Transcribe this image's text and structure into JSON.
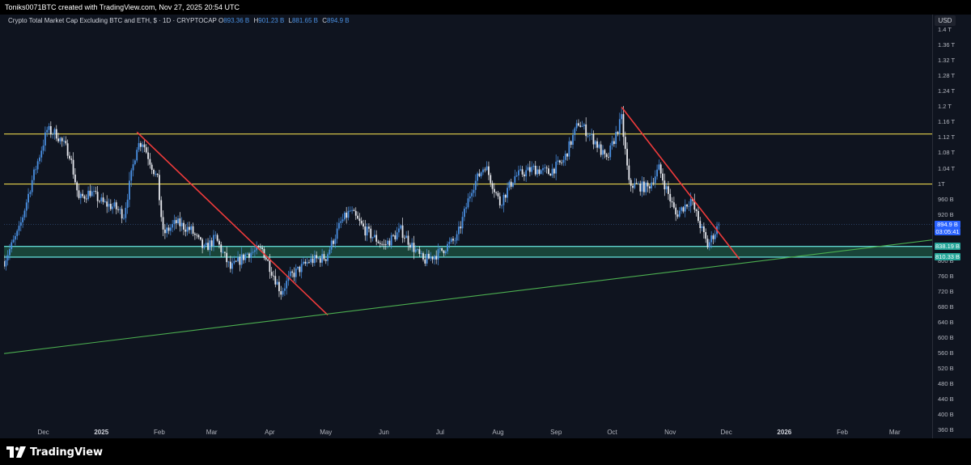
{
  "header": {
    "credit": "Toniks0071BTC created with TradingView.com, Nov 27, 2025 20:54 UTC"
  },
  "legend": {
    "symbol": "Crypto Total Market Cap Excluding BTC and ETH, $ · 1D · CRYPTOCAP",
    "o_label": "O",
    "o_value": "893.36 B",
    "h_label": "H",
    "h_value": "901.23 B",
    "l_label": "L",
    "l_value": "881.65 B",
    "c_label": "C",
    "c_value": "894.9 B"
  },
  "axis": {
    "currency": "USD"
  },
  "price_badges": {
    "last": "894.9 B",
    "countdown": "03:05:41",
    "support_upper": "838.19 B",
    "support_lower": "810.33 B"
  },
  "brand": {
    "name": "TradingView"
  },
  "colors": {
    "background": "#0f141f",
    "candle_up": "#4a90e2",
    "candle_down": "#e6e8ee",
    "resistance": "#e8d44d",
    "downtrend": "#ef3b3b",
    "uptrend": "#4caf50",
    "support_zone": "#2e9e6a",
    "support_line": "#5fd4cf",
    "last_price": "#2962ff"
  },
  "chart_data": {
    "type": "candlestick",
    "title": "Crypto Total Market Cap Excluding BTC and ETH, $ · 1D · CRYPTOCAP",
    "xlabel": "",
    "ylabel": "",
    "y_unit": "USD (billions)",
    "ylim": [
      340,
      1440
    ],
    "y_ticks": [
      360,
      400,
      440,
      480,
      520,
      560,
      600,
      640,
      680,
      720,
      760,
      800,
      840,
      880,
      920,
      960,
      1000,
      1040,
      1080,
      1120,
      1160,
      1200,
      1240,
      1280,
      1320,
      1360,
      1400
    ],
    "y_tick_labels": [
      "360 B",
      "400 B",
      "440 B",
      "480 B",
      "520 B",
      "560 B",
      "600 B",
      "640 B",
      "680 B",
      "720 B",
      "760 B",
      "800 B",
      "840 B",
      "880 B",
      "920 B",
      "960 B",
      "1T",
      "1.04 T",
      "1.08 T",
      "1.12 T",
      "1.16 T",
      "1.2 T",
      "1.24 T",
      "1.28 T",
      "1.32 T",
      "1.36 T",
      "1.4 T"
    ],
    "x_range": [
      "2024-11-10",
      "2026-03-21"
    ],
    "x_ticks": [
      {
        "date": "2024-12-01",
        "label": "Dec"
      },
      {
        "date": "2025-01-01",
        "label": "2025",
        "bold": true
      },
      {
        "date": "2025-02-01",
        "label": "Feb"
      },
      {
        "date": "2025-03-01",
        "label": "Mar"
      },
      {
        "date": "2025-04-01",
        "label": "Apr"
      },
      {
        "date": "2025-05-01",
        "label": "May"
      },
      {
        "date": "2025-06-01",
        "label": "Jun"
      },
      {
        "date": "2025-07-01",
        "label": "Jul"
      },
      {
        "date": "2025-08-01",
        "label": "Aug"
      },
      {
        "date": "2025-09-01",
        "label": "Sep"
      },
      {
        "date": "2025-10-01",
        "label": "Oct"
      },
      {
        "date": "2025-11-01",
        "label": "Nov"
      },
      {
        "date": "2025-12-01",
        "label": "Dec"
      },
      {
        "date": "2026-01-01",
        "label": "2026",
        "bold": true
      },
      {
        "date": "2026-02-01",
        "label": "Feb"
      },
      {
        "date": "2026-03-01",
        "label": "Mar"
      }
    ],
    "close_path": [
      {
        "date": "2024-11-10",
        "value": 800
      },
      {
        "date": "2024-11-18",
        "value": 880
      },
      {
        "date": "2024-11-25",
        "value": 1010
      },
      {
        "date": "2024-12-03",
        "value": 1140
      },
      {
        "date": "2024-12-08",
        "value": 1130
      },
      {
        "date": "2024-12-15",
        "value": 1080
      },
      {
        "date": "2024-12-20",
        "value": 960
      },
      {
        "date": "2024-12-26",
        "value": 980
      },
      {
        "date": "2025-01-02",
        "value": 950
      },
      {
        "date": "2025-01-08",
        "value": 940
      },
      {
        "date": "2025-01-13",
        "value": 920
      },
      {
        "date": "2025-01-20",
        "value": 1100
      },
      {
        "date": "2025-01-23",
        "value": 1110
      },
      {
        "date": "2025-01-31",
        "value": 1010
      },
      {
        "date": "2025-02-03",
        "value": 870
      },
      {
        "date": "2025-02-10",
        "value": 900
      },
      {
        "date": "2025-02-18",
        "value": 880
      },
      {
        "date": "2025-02-25",
        "value": 830
      },
      {
        "date": "2025-03-03",
        "value": 860
      },
      {
        "date": "2025-03-11",
        "value": 780
      },
      {
        "date": "2025-03-20",
        "value": 820
      },
      {
        "date": "2025-03-28",
        "value": 830
      },
      {
        "date": "2025-04-07",
        "value": 720
      },
      {
        "date": "2025-04-12",
        "value": 760
      },
      {
        "date": "2025-04-22",
        "value": 800
      },
      {
        "date": "2025-05-01",
        "value": 810
      },
      {
        "date": "2025-05-09",
        "value": 900
      },
      {
        "date": "2025-05-14",
        "value": 930
      },
      {
        "date": "2025-05-22",
        "value": 880
      },
      {
        "date": "2025-06-01",
        "value": 840
      },
      {
        "date": "2025-06-10",
        "value": 880
      },
      {
        "date": "2025-06-22",
        "value": 800
      },
      {
        "date": "2025-06-30",
        "value": 820
      },
      {
        "date": "2025-07-10",
        "value": 860
      },
      {
        "date": "2025-07-18",
        "value": 990
      },
      {
        "date": "2025-07-25",
        "value": 1050
      },
      {
        "date": "2025-08-02",
        "value": 950
      },
      {
        "date": "2025-08-10",
        "value": 1020
      },
      {
        "date": "2025-08-20",
        "value": 1040
      },
      {
        "date": "2025-08-28",
        "value": 1030
      },
      {
        "date": "2025-09-05",
        "value": 1060
      },
      {
        "date": "2025-09-13",
        "value": 1160
      },
      {
        "date": "2025-09-22",
        "value": 1110
      },
      {
        "date": "2025-09-28",
        "value": 1060
      },
      {
        "date": "2025-10-06",
        "value": 1170
      },
      {
        "date": "2025-10-10",
        "value": 1000
      },
      {
        "date": "2025-10-20",
        "value": 990
      },
      {
        "date": "2025-10-26",
        "value": 1040
      },
      {
        "date": "2025-11-04",
        "value": 920
      },
      {
        "date": "2025-11-12",
        "value": 960
      },
      {
        "date": "2025-11-18",
        "value": 880
      },
      {
        "date": "2025-11-21",
        "value": 840
      },
      {
        "date": "2025-11-27",
        "value": 894.9
      }
    ],
    "last_candle": {
      "date": "2025-11-27",
      "open": 893.36,
      "high": 901.23,
      "low": 881.65,
      "close": 894.9
    },
    "horizontal_levels": [
      {
        "role": "resistance",
        "value": 1130,
        "color": "#e8d44d"
      },
      {
        "role": "resistance",
        "value": 1000,
        "color": "#e8d44d"
      }
    ],
    "support_zone": {
      "from": 810.33,
      "to": 838.19
    },
    "trendlines": [
      {
        "role": "downtrend",
        "from": {
          "date": "2025-01-20",
          "value": 1135
        },
        "to": {
          "date": "2025-05-02",
          "value": 660
        }
      },
      {
        "role": "downtrend",
        "from": {
          "date": "2025-10-06",
          "value": 1200
        },
        "to": {
          "date": "2025-12-08",
          "value": 805
        }
      },
      {
        "role": "uptrend",
        "from": {
          "date": "2024-11-10",
          "value": 560
        },
        "to": {
          "date": "2026-03-21",
          "value": 855
        }
      }
    ],
    "grid": false,
    "legend_position": "top-left"
  }
}
